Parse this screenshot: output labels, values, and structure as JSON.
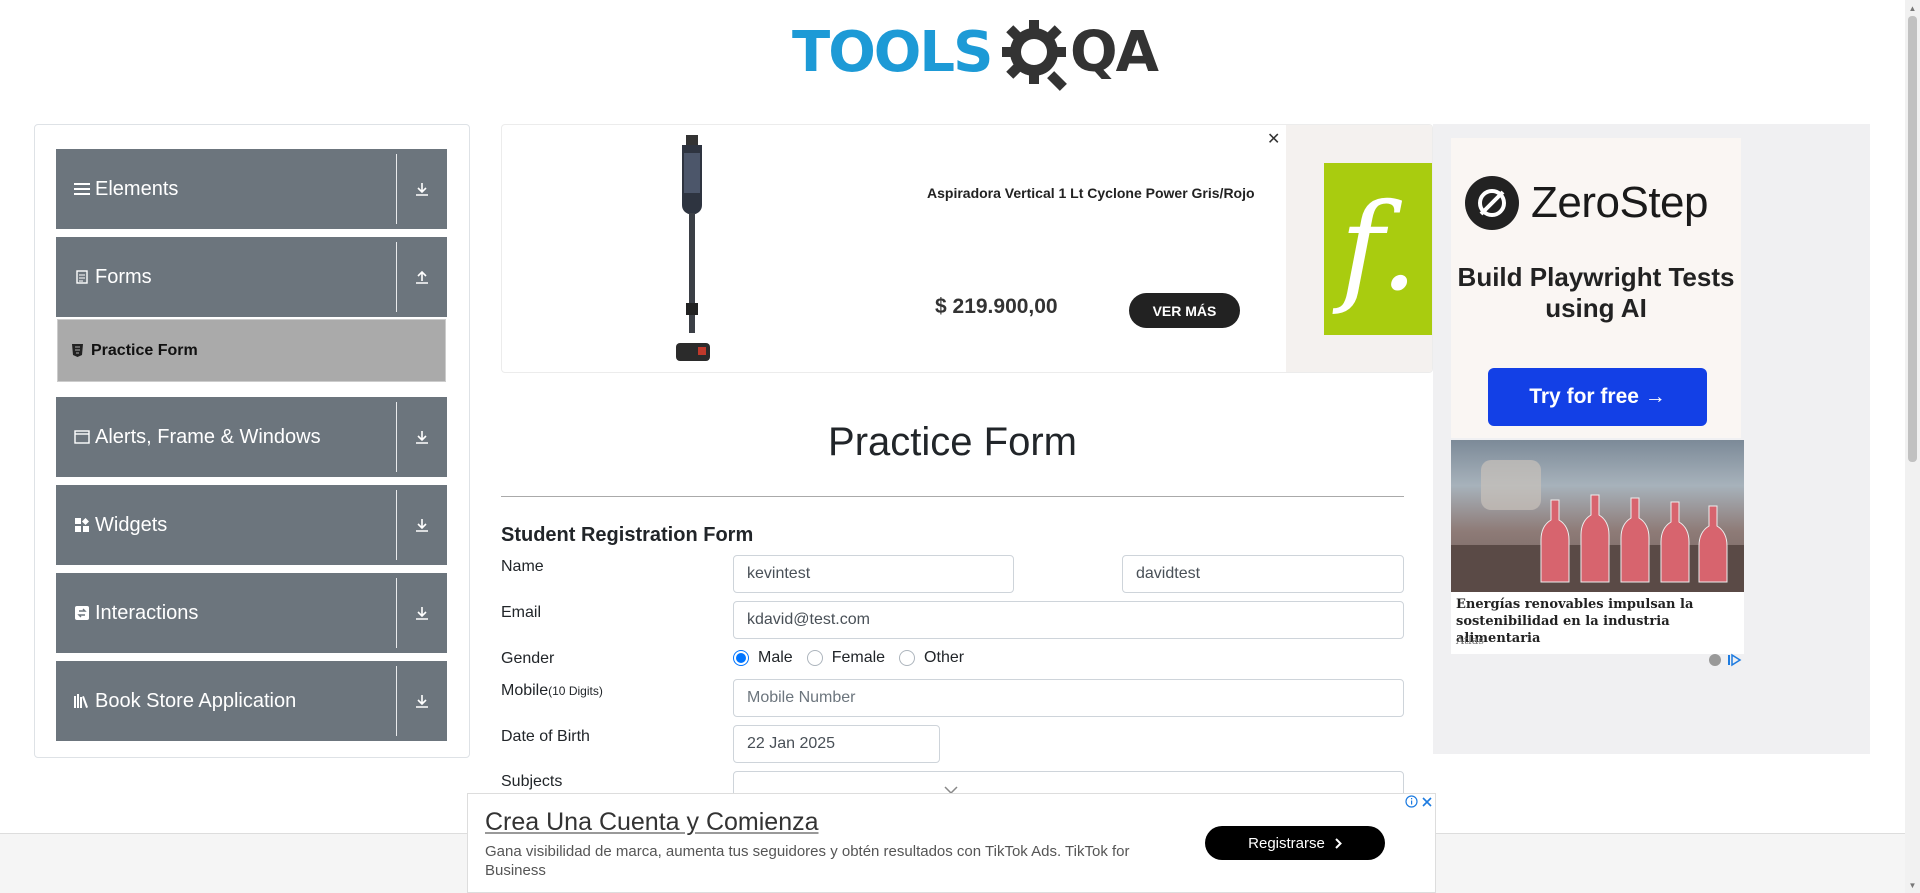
{
  "header": {
    "logo_tools": "TOOLS",
    "logo_qa": "QA"
  },
  "sidebar": {
    "groups": [
      {
        "label": "Elements",
        "icon": "hamburger-icon",
        "expanded": false
      },
      {
        "label": "Forms",
        "icon": "document-icon",
        "expanded": true
      },
      {
        "label": "Alerts, Frame & Windows",
        "icon": "window-icon",
        "expanded": false
      },
      {
        "label": "Widgets",
        "icon": "widgets-icon",
        "expanded": false
      },
      {
        "label": "Interactions",
        "icon": "interactions-icon",
        "expanded": false
      },
      {
        "label": "Book Store Application",
        "icon": "books-icon",
        "expanded": false
      }
    ],
    "active_item": "Practice Form"
  },
  "ad_top": {
    "product_title": "Aspiradora Vertical 1 Lt Cyclone Power Gris/Rojo",
    "price": "$ 219.900,00",
    "button": "VER MÁS",
    "close": "✕",
    "brand_letter": "f.",
    "brand_color": "#a9cc0f"
  },
  "ad_right": {
    "brand": "ZeroStep",
    "tagline": "Build Playwright Tests using AI",
    "button": "Try for free →",
    "news_title": "Energías renovables impulsan la sostenibilidad en la industria alimentaria",
    "news_source": "Atlas",
    "button_color": "#1340e6"
  },
  "form": {
    "page_title": "Practice Form",
    "subtitle": "Student Registration Form",
    "name_label": "Name",
    "first_name": "kevintest",
    "last_name": "davidtest",
    "email_label": "Email",
    "email": "kdavid@test.com",
    "gender_label": "Gender",
    "gender_options": [
      "Male",
      "Female",
      "Other"
    ],
    "gender_selected": "Male",
    "mobile_label": "Mobile",
    "mobile_hint": "(10 Digits)",
    "mobile_placeholder": "Mobile Number",
    "dob_label": "Date of Birth",
    "dob": "22 Jan 2025",
    "subjects_label": "Subjects"
  },
  "ad_bottom": {
    "title": "Crea Una Cuenta y Comienza",
    "description": "Gana visibilidad de marca, aumenta tus seguidores y obtén resultados con TikTok Ads. TikTok for Business",
    "button": "Registrarse"
  }
}
